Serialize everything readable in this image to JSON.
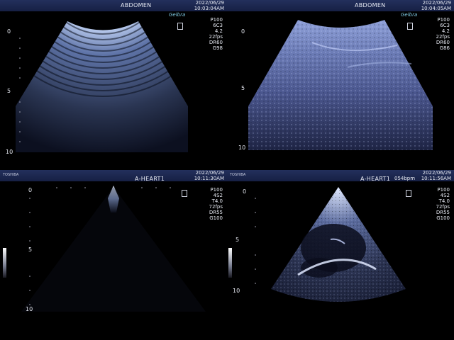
{
  "panels": [
    {
      "mode": "ABDOMEN",
      "date": "2022/06/29",
      "time": "10:03:04AM",
      "probe": "P100",
      "transducer": "6C3",
      "freq": "4.2",
      "fps": "22fps",
      "dr": "DR60",
      "gain": "G98",
      "depth_marks": [
        "0",
        "5",
        "10"
      ],
      "signature": "Gelbra",
      "accent": "#8aa4ff"
    },
    {
      "mode": "ABDOMEN",
      "date": "2022/06/29",
      "time": "10:04:05AM",
      "probe": "P100",
      "transducer": "6C3",
      "freq": "4.2",
      "fps": "22fps",
      "dr": "DR60",
      "gain": "G86",
      "depth_marks": [
        "0",
        "5",
        "10"
      ],
      "signature": "Gelbra",
      "accent": "#8aa4ff"
    },
    {
      "maker": "TOSHIBA",
      "mode": "A-HEART1",
      "date": "2022/06/29",
      "time": "10:11:30AM",
      "probe": "P100",
      "transducer": "4S2",
      "freq": "T4.0",
      "fps": "72fps",
      "dr": "DR55",
      "gain": "G100",
      "depth_marks": [
        "0",
        "5",
        "10"
      ],
      "accent": "#ffffff"
    },
    {
      "maker": "TOSHIBA",
      "mode": "A-HEART1",
      "bpm": "054bpm",
      "date": "2022/06/29",
      "time": "10:11:56AM",
      "probe": "P100",
      "transducer": "4S2",
      "freq": "T4.0",
      "fps": "72fps",
      "dr": "DR55",
      "gain": "G100",
      "depth_marks": [
        "0",
        "5",
        "10"
      ],
      "accent": "#ffffff"
    }
  ]
}
